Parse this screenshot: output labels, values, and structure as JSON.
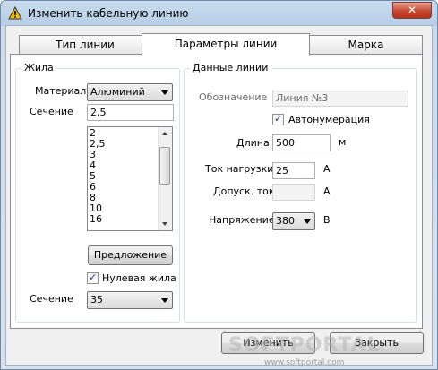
{
  "window": {
    "title": "Изменить кабельную линию",
    "close_symbol": "✕"
  },
  "tabs": [
    {
      "label": "Тип линии",
      "active": false
    },
    {
      "label": "Параметры линии",
      "active": true
    },
    {
      "label": "Марка",
      "active": false
    }
  ],
  "core_group": {
    "label": "Жила",
    "material_label": "Материал",
    "material_value": "Алюминий",
    "section_label": "Сечение",
    "section_value": "2,5",
    "section_list": [
      "2",
      "2,5",
      "3",
      "4",
      "5",
      "6",
      "8",
      "10",
      "16"
    ],
    "suggest_button": "Предложение",
    "zero_core_label": "Нулевая жила",
    "zero_core_checked": true,
    "zero_section_label": "Сечение",
    "zero_section_value": "35"
  },
  "line_group": {
    "label": "Данные линии",
    "designation_label": "Обозначение",
    "designation_value": "Линия №3",
    "autonumber_label": "Автонумерация",
    "autonumber_checked": true,
    "length_label": "Длина",
    "length_value": "500",
    "length_unit": "м",
    "load_current_label": "Ток нагрузки",
    "load_current_value": "25",
    "load_current_unit": "А",
    "allowed_current_label": "Допуск. ток",
    "allowed_current_value": "",
    "allowed_current_unit": "А",
    "voltage_label": "Напряжение",
    "voltage_value": "380",
    "voltage_unit": "В"
  },
  "footer": {
    "change_button": "Изменить",
    "close_button": "Закрыть"
  },
  "watermark": {
    "text": "SOFTPORTAL",
    "url": "www.softportal.com"
  },
  "icons": {
    "title_icon": "warning-triangle-icon"
  }
}
